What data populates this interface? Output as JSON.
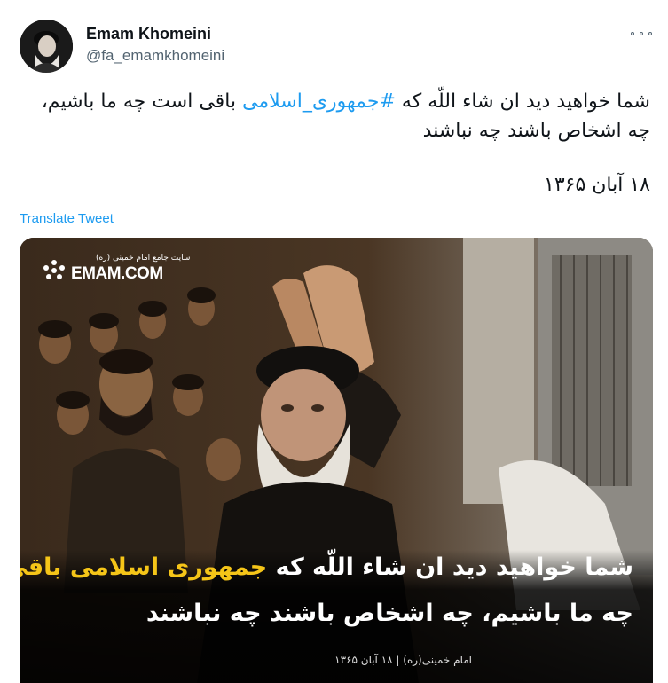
{
  "author": {
    "display_name": "Emam Khomeini",
    "handle": "@fa_emamkhomeini"
  },
  "tweet": {
    "text_before": "شما خواهید دید ان شاء اللّه که ",
    "hashtag": "#جمهوری_اسلامی",
    "text_after": " باقی است چه ما باشیم، چه اشخاص باشند چه نباشند",
    "date": "۱۸ آبان ۱۳۶۵",
    "translate_label": "Translate Tweet"
  },
  "media": {
    "logo_small": "سایت جامع امام خمینی (ره)",
    "logo_big": "EMAM.COM",
    "caption_line1_white": "شما خواهید دید ان شاء اللّه که ",
    "caption_line1_yellow": "جمهوری اسلامی باقی است",
    "caption_line2": "چه ما باشیم، چه اشخاص باشند چه نباشند",
    "credit": "امام خمینی(ره) | ۱۸ آبان ۱۳۶۵"
  },
  "colors": {
    "link": "#1d9bf0",
    "caption_highlight": "#f5c518"
  },
  "icons": {
    "more": "more-horizontal-icon"
  }
}
